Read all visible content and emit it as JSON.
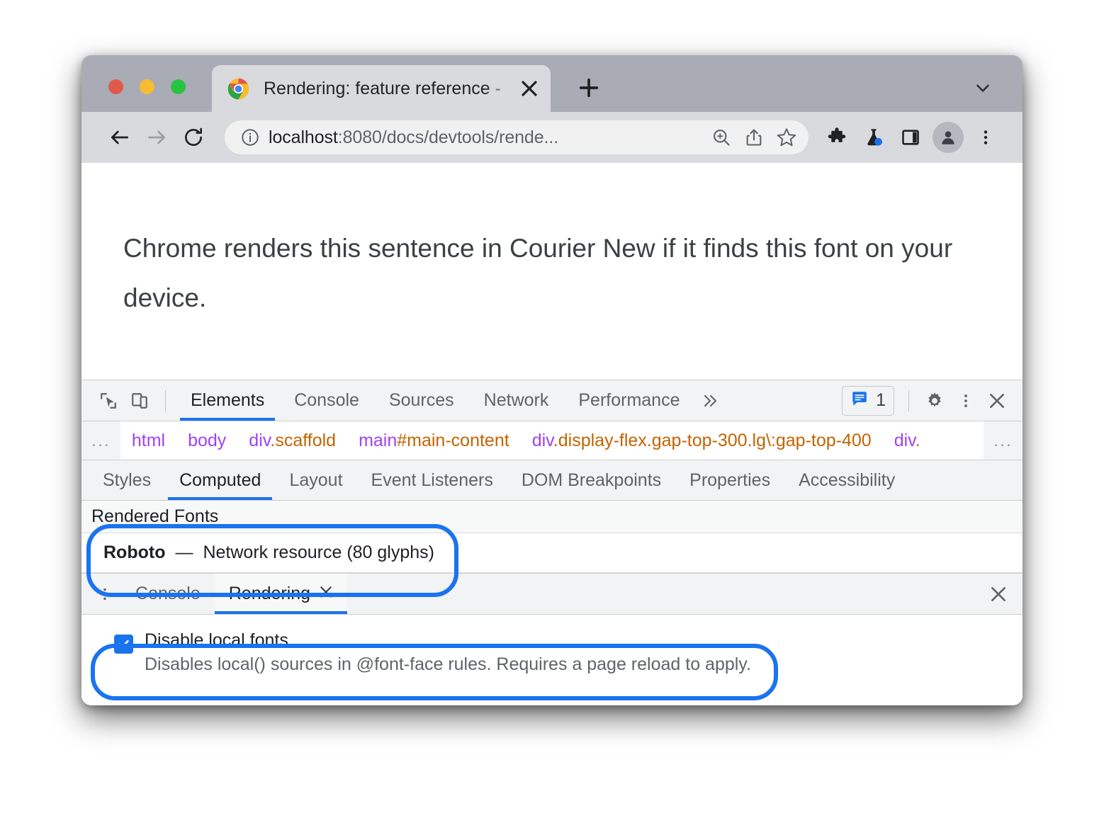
{
  "browser": {
    "tab": {
      "title": "Rendering: feature reference - ",
      "favicon": "chrome-logo-icon",
      "close": "close-icon"
    },
    "new_tab_label": "+",
    "omnibox": {
      "host": "localhost",
      "path": ":8080/docs/devtools/rende...",
      "info_icon": "info-circle-icon"
    },
    "toolbar_icons": [
      "back-icon",
      "forward-icon",
      "reload-icon",
      "zoom-in-icon",
      "share-icon",
      "bookmark-star-icon",
      "extensions-puzzle-icon",
      "labs-flask-icon",
      "side-panel-icon",
      "profile-avatar-icon",
      "browser-menu-icon"
    ]
  },
  "page": {
    "sentence": "Chrome renders this sentence in Courier New if it finds this font on your device."
  },
  "devtools": {
    "toolbar": {
      "inspect_icon": "inspect-cursor-icon",
      "device_icon": "device-toolbar-icon",
      "more_tabs_icon": "chevron-double-right-icon",
      "issues_icon": "issues-message-icon",
      "issues_count": "1",
      "settings_icon": "gear-icon",
      "more_icon": "dots-vertical-icon",
      "close_icon": "close-icon"
    },
    "panels": [
      {
        "label": "Elements",
        "active": true
      },
      {
        "label": "Console",
        "active": false
      },
      {
        "label": "Sources",
        "active": false
      },
      {
        "label": "Network",
        "active": false
      },
      {
        "label": "Performance",
        "active": false
      }
    ],
    "breadcrumb": {
      "leading_ellipsis": "...",
      "trailing_ellipsis": "...",
      "items": [
        {
          "tag": "html",
          "spec": ""
        },
        {
          "tag": "body",
          "spec": ""
        },
        {
          "tag": "div",
          "spec": ".scaffold"
        },
        {
          "tag": "main",
          "spec": "#main-content"
        },
        {
          "tag": "div",
          "spec": ".display-flex.gap-top-300.lg\\:gap-top-400"
        },
        {
          "tag": "div",
          "spec": "."
        }
      ]
    },
    "sidebar_tabs": [
      {
        "label": "Styles",
        "active": false
      },
      {
        "label": "Computed",
        "active": true
      },
      {
        "label": "Layout",
        "active": false
      },
      {
        "label": "Event Listeners",
        "active": false
      },
      {
        "label": "DOM Breakpoints",
        "active": false
      },
      {
        "label": "Properties",
        "active": false
      },
      {
        "label": "Accessibility",
        "active": false
      }
    ],
    "computed": {
      "rendered_fonts_header": "Rendered Fonts",
      "font_name": "Roboto",
      "font_dash": "—",
      "font_description": "Network resource (80 glyphs)"
    },
    "drawer": {
      "menu_icon": "dots-vertical-icon",
      "tabs": [
        {
          "label": "Console",
          "active": false,
          "closable": false
        },
        {
          "label": "Rendering",
          "active": true,
          "closable": true
        }
      ],
      "close_icon": "close-icon",
      "tab_close_icon": "close-icon",
      "settings": [
        {
          "label": "Disable local fonts",
          "description": "Disables local() sources in @font-face rules. Requires a page reload to apply.",
          "checked": true
        }
      ]
    }
  },
  "annotations": {
    "highlight_color": "#1a73f0",
    "rings": [
      "rendered-fonts-highlight",
      "disable-local-fonts-highlight"
    ]
  }
}
